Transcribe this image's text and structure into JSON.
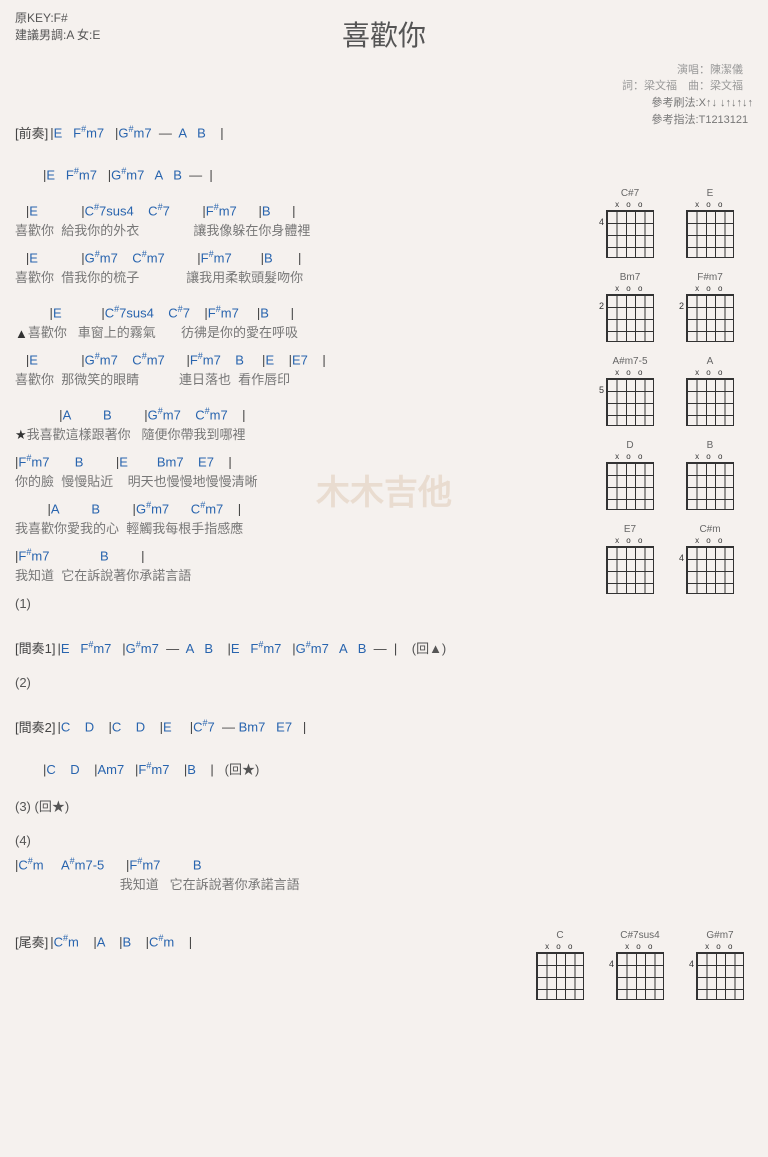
{
  "header": {
    "origKey": "原KEY:F#",
    "suggest": "建議男調:A 女:E",
    "title": "喜歡你",
    "singer_label": "演唱：",
    "singer": "陳潔儀",
    "lyrics_label": "詞：",
    "lyricist": "梁文福",
    "music_label": "曲：",
    "composer": "梁文福",
    "ref1": "參考刷法:X↑↓ ↓↑↓↑↓↑",
    "ref2": "參考指法:T1213121"
  },
  "intro": {
    "label": "[前奏]",
    "l1": "|E   F#m7   |G#m7  —  A   B    |",
    "l2": "|E   F#m7   |G#m7   A   B  —  |"
  },
  "v1": {
    "l1_c": "   |E            |C#7sus4    C#7         |F#m7      |B      |",
    "l1_t": "喜歡你  給我你的外衣               讓我像躲在你身體裡",
    "l2_c": "   |E            |G#m7    C#m7         |F#m7        |B       |",
    "l2_t": "喜歡你  借我你的梳子             讓我用柔軟頭髮吻你"
  },
  "v2": {
    "m": "▲",
    "l1_c": "      |E           |C#7sus4    C#7    |F#m7     |B      |",
    "l1_t": "喜歡你   車窗上的霧氣       彷彿是你的愛在呼吸",
    "l2_c": "   |E            |G#m7    C#m7      |F#m7    B     |E    |E7    |",
    "l2_t": "喜歡你  那微笑的眼睛           連日落也  看作唇印"
  },
  "ch": {
    "m": "★",
    "l1_c": "         |A         B         |G#m7    C#m7    |",
    "l1_t": "我喜歡這樣跟著你   隨便你帶我到哪裡",
    "l2_c": "|F#m7       B         |E        Bm7    E7    |",
    "l2_t": "你的臉  慢慢貼近    明天也慢慢地慢慢清晰",
    "l3_c": "         |A         B         |G#m7      C#m7    |",
    "l3_t": "我喜歡你愛我的心  輕觸我每根手指感應",
    "l4_c": "|F#m7              B         |",
    "l4_t": "我知道  它在訴說著你承諾言語"
  },
  "num1": "(1)",
  "inter1": {
    "label": "[間奏1]",
    "l1": "|E   F#m7   |G#m7  —  A   B    |E   F#m7   |G#m7   A   B  —  |    (回▲)"
  },
  "num2": "(2)",
  "inter2": {
    "label": "[間奏2]",
    "l1": "|C    D    |C    D    |E     |C#7  — Bm7   E7   |",
    "l2": "|C    D    |Am7   |F#m7    |B    |   (回★)"
  },
  "num3": "(3) (回★)",
  "num4": "(4)",
  "end": {
    "c": "|C#m     A#m7-5      |F#m7         B",
    "t": "                             我知道   它在訴說著你承諾言語"
  },
  "outro": {
    "label": "[尾奏]",
    "l1": "|C#m    |A    |B    |C#m    |"
  },
  "diagrams": [
    [
      "C#7",
      "E"
    ],
    [
      "Bm7",
      "F#m7"
    ],
    [
      "A#m7-5",
      "A"
    ],
    [
      "D",
      "B"
    ],
    [
      "E7",
      "C#m"
    ]
  ],
  "diagrams2": [
    "C",
    "C#7sus4",
    "G#m7"
  ],
  "frets": {
    "C#7": "4",
    "Bm7": "2",
    "F#m7": "2",
    "A#m7-5": "5",
    "C#m": "4",
    "C#7sus4": "4",
    "G#m7": "4"
  },
  "watermark": "木木吉他"
}
